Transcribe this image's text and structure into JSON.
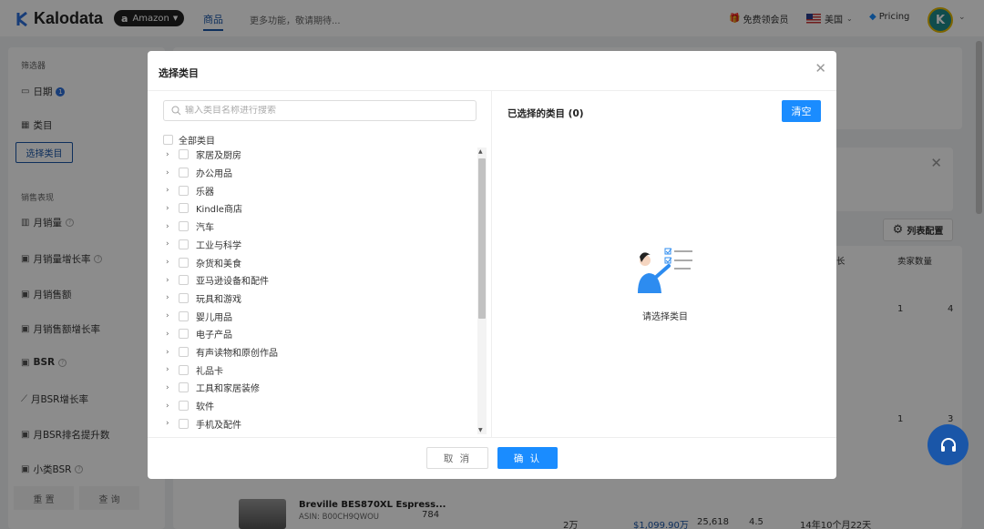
{
  "header": {
    "brand": "Kalodata",
    "marketplace": "Amazon",
    "nav_active": "商品",
    "nav_more": "更多功能，敬请期待...",
    "free_member": "免费领会员",
    "country": "美国",
    "pricing": "Pricing",
    "avatar_letter": "K"
  },
  "sidebar": {
    "section_filter": "筛选器",
    "date_label": "日期",
    "date_badge": "1",
    "category_label": "类目",
    "select_category_btn": "选择类目",
    "section_sales": "销售表现",
    "metrics": [
      "月销量",
      "月销量增长率",
      "月销售额",
      "月销售额增长率",
      "BSR",
      "月BSR增长率",
      "月BSR排名提升数",
      "小类BSR"
    ],
    "reset_btn": "重 置",
    "query_btn": "查 询"
  },
  "background": {
    "column_config": "列表配置",
    "col_growth": "长",
    "col_sellers": "卖家数量",
    "row1_sellers": "1",
    "row1_last": "4",
    "row2_sellers": "1",
    "row2_last": "3",
    "product_title": "Breville BES870XL Espress...",
    "product_asin": "ASIN: B00CH9QWOU",
    "product_qty": "784",
    "product_vol": "2万",
    "product_sales": "$1,099.90万",
    "product_reviews": "25,618",
    "product_rating": "4.5",
    "product_age": "14年10个月22天"
  },
  "modal": {
    "title": "选择类目",
    "search_placeholder": "输入类目名称进行搜索",
    "all_categories": "全部类目",
    "categories": [
      "家居及厨房",
      "办公用品",
      "乐器",
      "Kindle商店",
      "汽车",
      "工业与科学",
      "杂货和美食",
      "亚马逊设备和配件",
      "玩具和游戏",
      "婴儿用品",
      "电子产品",
      "有声读物和原创作品",
      "礼品卡",
      "工具和家居装修",
      "软件",
      "手机及配件"
    ],
    "selected_title": "已选择的类目 (0)",
    "clear_btn": "清空",
    "empty_text": "请选择类目",
    "cancel_btn": "取 消",
    "confirm_btn": "确 认"
  },
  "colors": {
    "primary": "#1a8cff",
    "brand_blue": "#1a56a8",
    "overlay": "rgba(0,0,0,0.45)"
  }
}
